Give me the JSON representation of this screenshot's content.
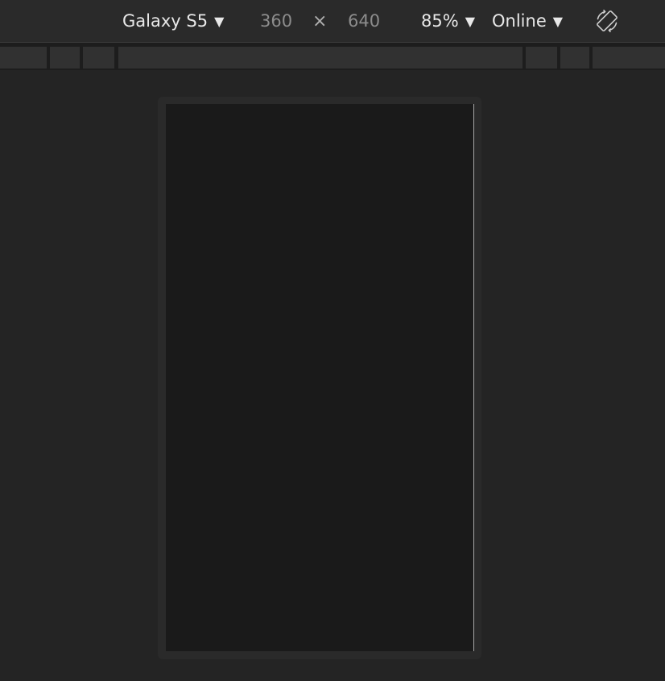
{
  "toolbar": {
    "device_label": "Galaxy S5",
    "width_value": "360",
    "times_symbol": "×",
    "height_value": "640",
    "zoom_label": "85%",
    "throttle_label": "Online",
    "caret_glyph": "▼",
    "rotate_icon": "rotate-device-icon"
  },
  "colors": {
    "background": "#242424",
    "toolbar": "#2a2a2a",
    "viewport": "#1a1a1a",
    "text": "#e8e8e8",
    "dim_text": "#8c8c8c"
  }
}
